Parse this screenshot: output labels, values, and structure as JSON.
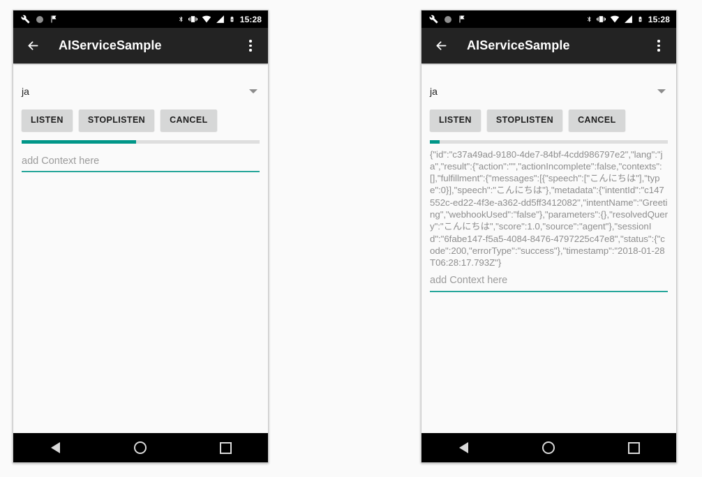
{
  "theme": {
    "accent": "#009688",
    "underline": "#26a69a",
    "status_bar_bg": "#000000",
    "toolbar_bg": "#232323",
    "content_bg": "#fafafa",
    "button_bg": "#d6d7d7",
    "result_text_color": "#8e8e8e",
    "progress_track": "#dedede"
  },
  "status_bar": {
    "icons_left": [
      "wrench-icon",
      "circle-dot-icon",
      "flag-icon"
    ],
    "icons_right": [
      "bluetooth-icon",
      "vibrate-icon",
      "wifi-icon",
      "signal-icon",
      "battery-charging-icon"
    ],
    "clock": "15:28"
  },
  "toolbar": {
    "back_icon": "arrow-back-icon",
    "title": "AIServiceSample",
    "overflow_icon": "overflow-menu-icon"
  },
  "spinner": {
    "selected": "ja",
    "arrow_icon": "chevron-down-icon"
  },
  "buttons": {
    "listen": "LISTEN",
    "stop_listen": "STOPLISTEN",
    "cancel": "CANCEL"
  },
  "nav_bar": {
    "back": "back-nav-icon",
    "home": "home-nav-icon",
    "recents": "recents-nav-icon"
  },
  "edit_text": {
    "hint": "add Context here",
    "value": ""
  },
  "panels": {
    "left": {
      "progress_percent": 48,
      "result_text": ""
    },
    "right": {
      "progress_percent": 4,
      "result_text": "{\"id\":\"c37a49ad-9180-4de7-84bf-4cdd986797e2\",\"lang\":\"ja\",\"result\":{\"action\":\"\",\"actionIncomplete\":false,\"contexts\":[],\"fulfillment\":{\"messages\":[{\"speech\":[\"こんにちは\"],\"type\":0}],\"speech\":\"こんにちは\"},\"metadata\":{\"intentId\":\"c147552c-ed22-4f3e-a362-dd5ff3412082\",\"intentName\":\"Greeting\",\"webhookUsed\":\"false\"},\"parameters\":{},\"resolvedQuery\":\"こんにちは\",\"score\":1.0,\"source\":\"agent\"},\"sessionId\":\"6fabe147-f5a5-4084-8476-4797225c47e8\",\"status\":{\"code\":200,\"errorType\":\"success\"},\"timestamp\":\"2018-01-28T06:28:17.793Z\"}"
    }
  }
}
